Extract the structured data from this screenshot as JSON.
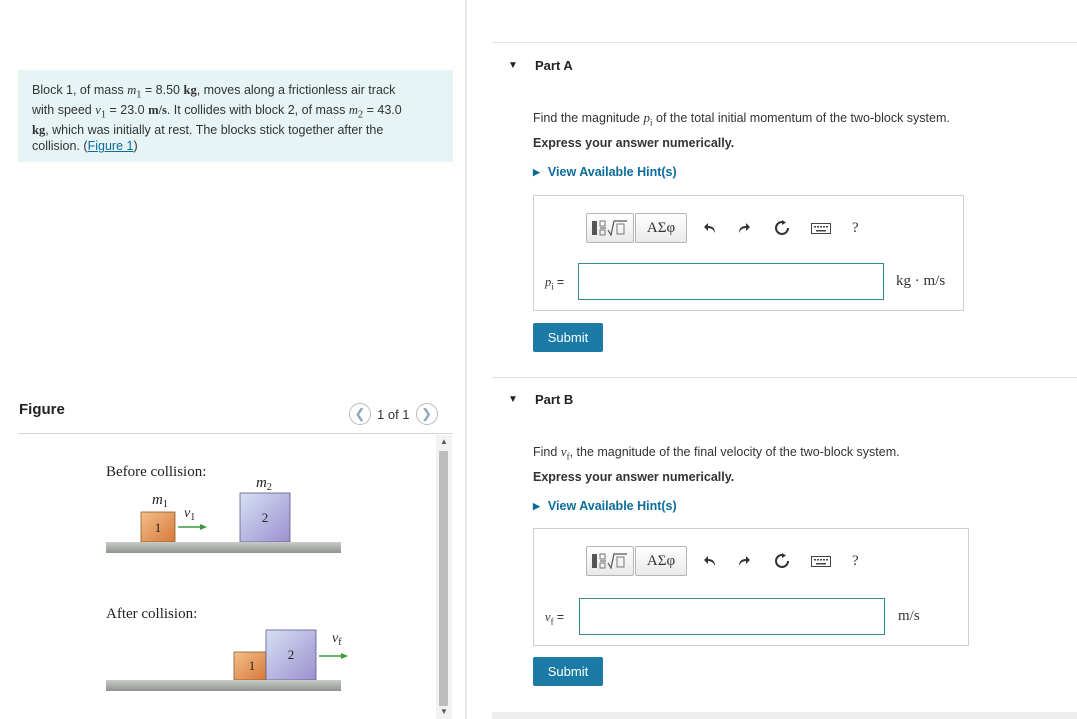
{
  "problem": {
    "line1": "Block 1, of mass",
    "m1_sym": "m",
    "m1_sub": "1",
    "m1_value": "= 8.50",
    "kg_unit": "kg",
    "line1_end": ", moves along a frictionless air track",
    "with_speed": "with speed",
    "v1_sym": "v",
    "v1_sub": "1",
    "v1_value": "= 23.0",
    "ms_unit": "m/s",
    "collides": ". It collides with block 2, of mass",
    "m2_sym": "m",
    "m2_sub": "2",
    "m2_value": "= 43.0",
    "kg_unit2": "kg",
    "line3_end": ", which was initially at rest. The blocks stick together after the",
    "line4": "collision.",
    "figure_link": "Figure 1"
  },
  "figure": {
    "label": "Figure",
    "counter": "1 of 1",
    "before_label": "Before collision:",
    "after_label": "After collision:",
    "m1_label": "m",
    "m1_sub": "1",
    "m2_label": "m",
    "m2_sub": "2",
    "v1_label": "v",
    "v1_sub": "1",
    "vf_label": "v",
    "vf_sub": "f",
    "block1": "1",
    "block2": "2"
  },
  "partA": {
    "title": "Part A",
    "q_prefix": "Find the magnitude",
    "q_sym": "p",
    "q_sub": "i",
    "q_suffix": "of the total initial momentum of the two-block system.",
    "express": "Express your answer numerically.",
    "hint": "View Available Hint(s)",
    "greek": "ΑΣφ",
    "help": "?",
    "var": "p",
    "var_sub": "i",
    "equals": "=",
    "value": "",
    "unit": "kg · m/s",
    "submit": "Submit"
  },
  "partB": {
    "title": "Part B",
    "q_prefix": "Find",
    "q_sym": "v",
    "q_sub": "f",
    "q_suffix": ", the magnitude of the final velocity of the two-block system.",
    "express": "Express your answer numerically.",
    "hint": "View Available Hint(s)",
    "greek": "ΑΣφ",
    "help": "?",
    "var": "v",
    "var_sub": "f",
    "equals": "=",
    "value": "",
    "unit": "m/s",
    "submit": "Submit"
  },
  "colors": {
    "accent": "#1b7ba6",
    "problem_bg": "#e6f4f6",
    "block1": "#e8a15d",
    "block2": "#b8b4e0",
    "arrow": "#3a9a3a",
    "track": "#a5aaa5"
  },
  "icons": [
    "caret-down-icon",
    "caret-right-icon",
    "fraction-sqrt-icon",
    "undo-icon",
    "redo-icon",
    "reset-icon",
    "keyboard-icon",
    "help-icon",
    "chevron-left-icon",
    "chevron-right-icon"
  ]
}
